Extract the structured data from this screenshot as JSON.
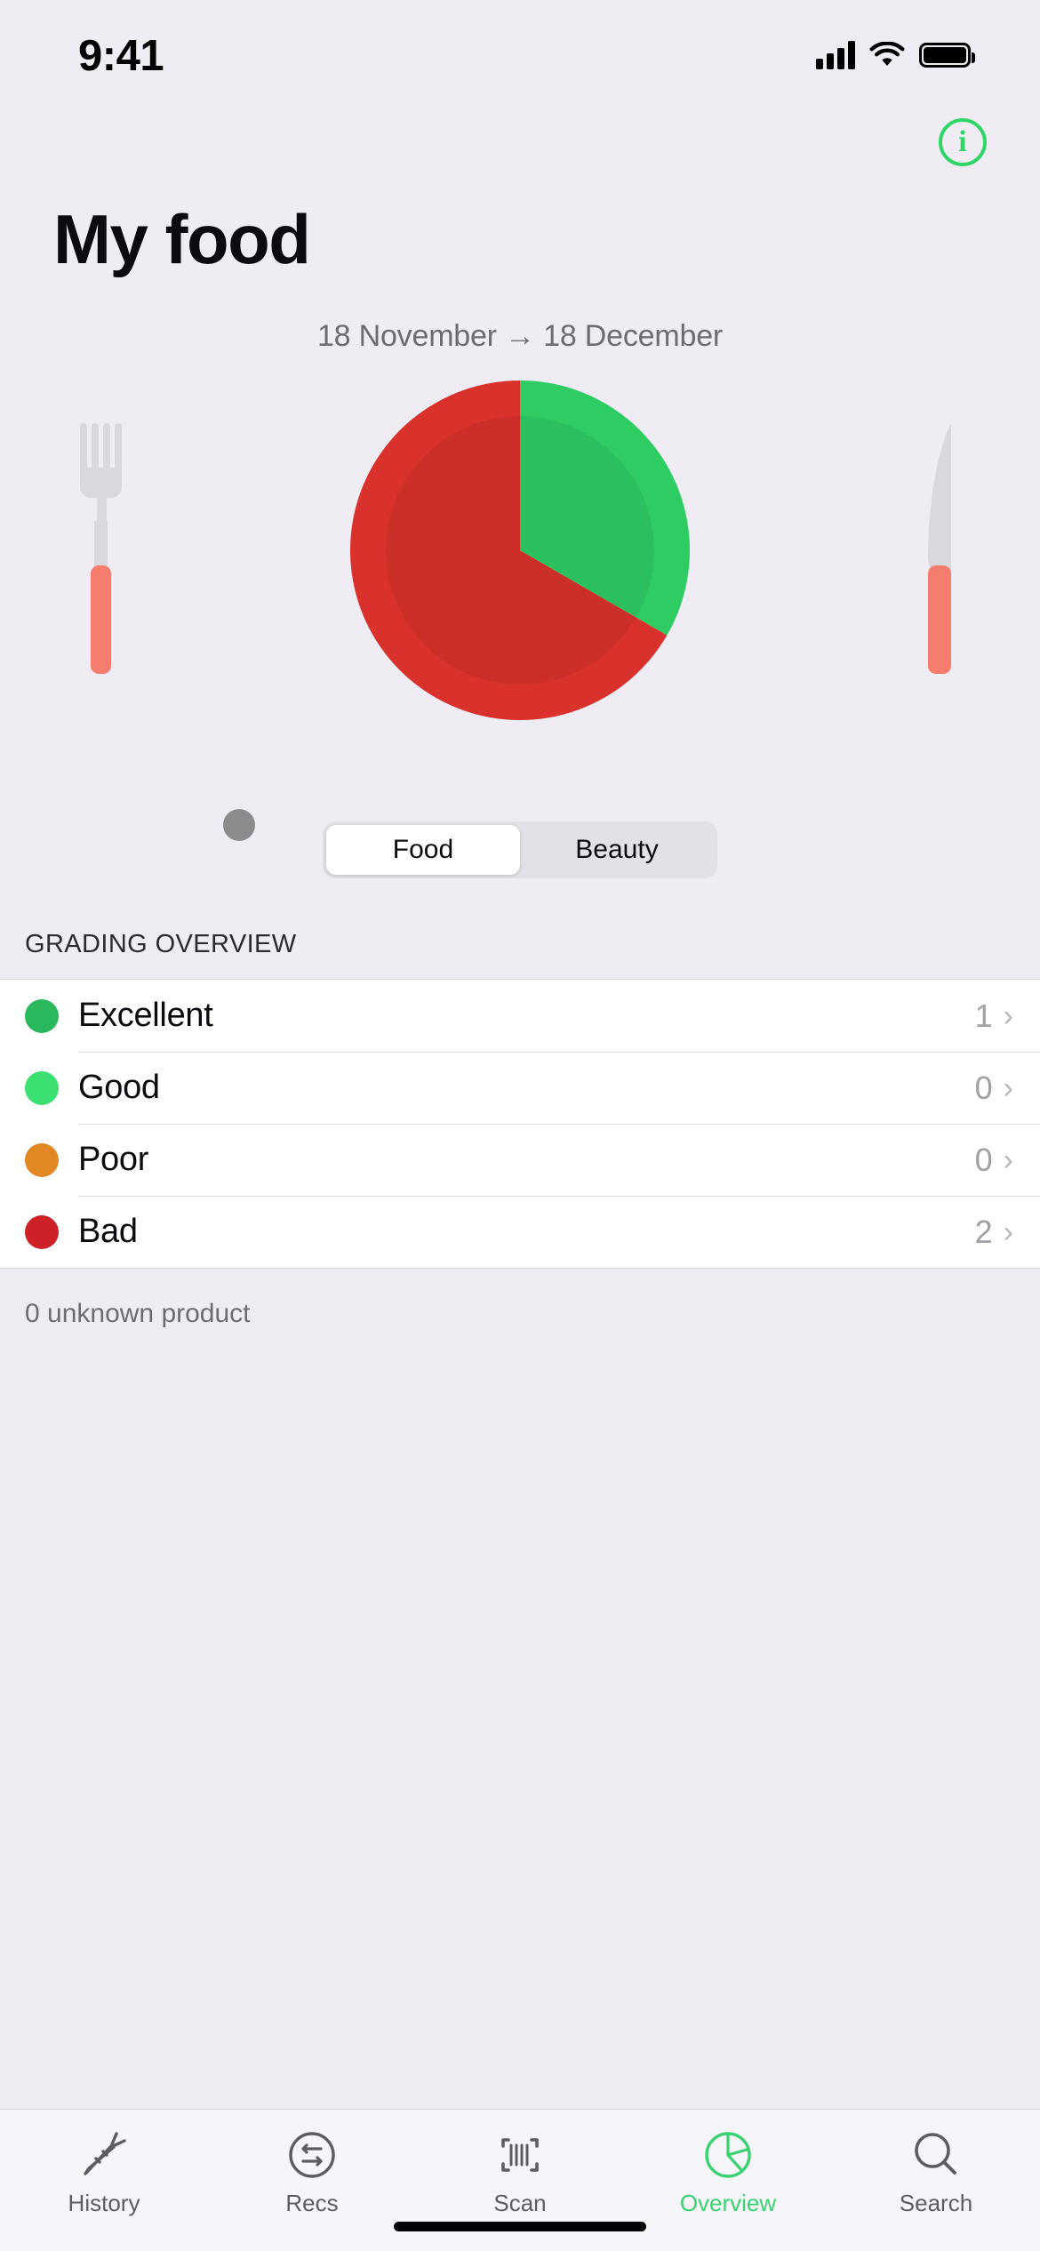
{
  "status_bar": {
    "time": "9:41",
    "signal_icon": "cellular-bars-icon",
    "wifi_icon": "wifi-icon",
    "battery_icon": "battery-full-icon"
  },
  "header": {
    "title": "My food",
    "info_button_label": "i",
    "info_icon": "info-circle-icon"
  },
  "date_range": {
    "text": "18 November → 18 December",
    "start": "18 November",
    "end": "18 December"
  },
  "segmented_control": {
    "options": [
      {
        "label": "Food",
        "selected": true
      },
      {
        "label": "Beauty",
        "selected": false
      }
    ]
  },
  "grading": {
    "section_title": "GRADING OVERVIEW",
    "rows": [
      {
        "label": "Excellent",
        "count": "1",
        "color": "#2bb85c",
        "chevron": "›"
      },
      {
        "label": "Good",
        "count": "0",
        "color": "#3ae072",
        "chevron": "›"
      },
      {
        "label": "Poor",
        "count": "0",
        "color": "#e18824",
        "chevron": "›"
      },
      {
        "label": "Bad",
        "count": "2",
        "color": "#ce2027",
        "chevron": "›"
      }
    ],
    "footnote": "0 unknown product"
  },
  "tab_bar": {
    "tabs": [
      {
        "label": "History",
        "icon": "carrot-icon",
        "active": false
      },
      {
        "label": "Recs",
        "icon": "swap-arrows-circle-icon",
        "active": false
      },
      {
        "label": "Scan",
        "icon": "barcode-scan-icon",
        "active": false
      },
      {
        "label": "Overview",
        "icon": "pie-chart-icon",
        "active": true
      },
      {
        "label": "Search",
        "icon": "magnifier-icon",
        "active": false
      }
    ]
  },
  "colors": {
    "accent_green": "#3ad271",
    "background": "#efedf3",
    "card": "#ffffff",
    "plate_red": "#d9322c",
    "plate_green": "#2ecc63",
    "cutlery_handle": "#f47d6e",
    "cutlery_metal": "#d8d8dd"
  },
  "chart_data": {
    "type": "pie",
    "title": "My food",
    "categories": [
      "Excellent",
      "Good",
      "Poor",
      "Bad"
    ],
    "values": [
      1,
      0,
      0,
      2
    ],
    "colors": [
      "#2bb85c",
      "#3ae072",
      "#e18824",
      "#ce2027"
    ],
    "rendered_slices": [
      {
        "name": "Green (good grades)",
        "color": "#2ecc63",
        "value": 1,
        "percent": 33.3,
        "start_angle_deg": 0,
        "end_angle_deg": 120
      },
      {
        "name": "Red (bad grades)",
        "color": "#d9322c",
        "value": 2,
        "percent": 66.7,
        "start_angle_deg": 120,
        "end_angle_deg": 360
      }
    ],
    "total": 3,
    "legend_position": "below-as-list",
    "annotations": [
      "Plate illustration with fork and knife",
      "0 unknown product"
    ]
  }
}
